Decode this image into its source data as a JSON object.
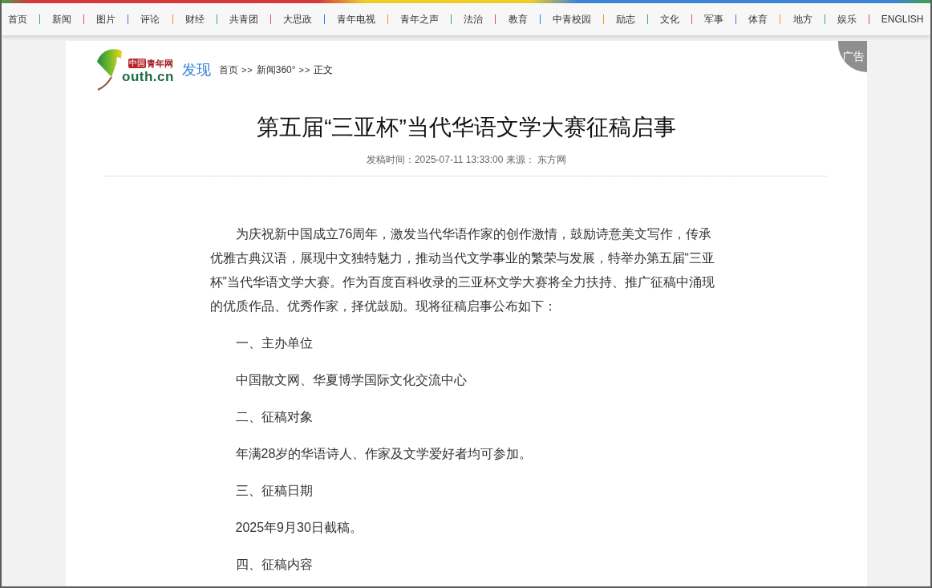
{
  "nav": {
    "items": [
      "首页",
      "新闻",
      "图片",
      "评论",
      "财经",
      "共青团",
      "大思政",
      "青年电视",
      "青年之声",
      "法治",
      "教育",
      "中青校园",
      "励志",
      "文化",
      "军事",
      "体育",
      "地方",
      "娱乐",
      "ENGLISH"
    ]
  },
  "header": {
    "logo": {
      "badge": "中国",
      "name": "青年网",
      "domain": "outh.cn"
    },
    "channel": "发现",
    "breadcrumb": {
      "separator": ">>",
      "links": [
        "首页",
        "新闻360°"
      ],
      "current": "正文"
    },
    "ad_label": "广告"
  },
  "article": {
    "title": "第五届“三亚杯”当代华语文学大赛征稿启事",
    "meta": "发稿时间：2025-07-11 13:33:00 来源： 东方网",
    "paragraphs": [
      "为庆祝新中国成立76周年，激发当代华语作家的创作激情，鼓励诗意美文写作，传承优雅古典汉语，展现中文独特魅力，推动当代文学事业的繁荣与发展，特举办第五届“三亚杯”当代华语文学大赛。作为百度百科收录的三亚杯文学大赛将全力扶持、推广征稿中涌现的优质作品、优秀作家，择优鼓励。现将征稿启事公布如下：",
      "一、主办单位",
      "中国散文网、华夏博学国际文化交流中心",
      "二、征稿对象",
      "年满28岁的华语诗人、作家及文学爱好者均可参加。",
      "三、征稿日期",
      "2025年9月30日截稿。",
      "四、征稿内容"
    ]
  }
}
